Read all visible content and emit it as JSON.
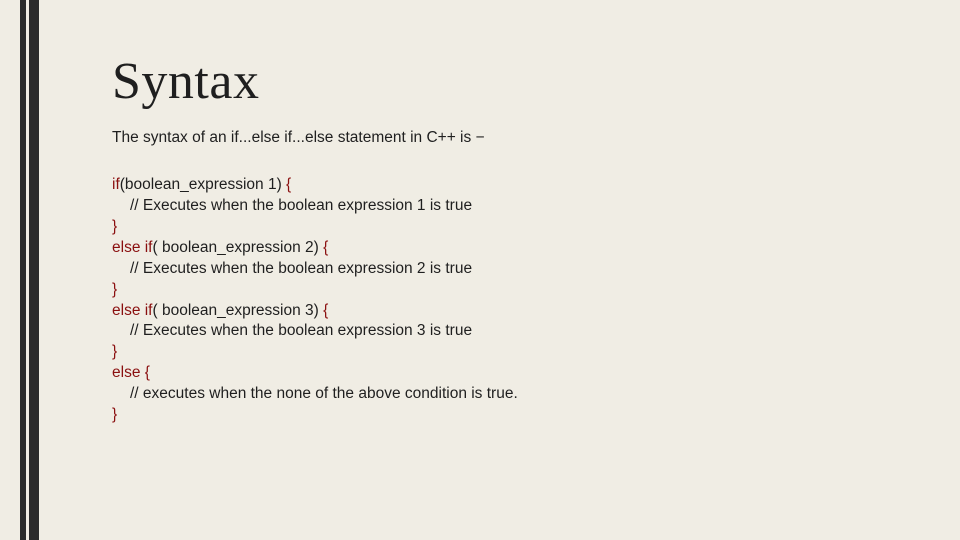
{
  "title": "Syntax",
  "intro": "The syntax of an if...else if...else statement in C++ is −",
  "code": {
    "l1a": "if",
    "l1b": "(boolean_expression 1)",
    "l1c": " {",
    "l2": "// Executes when the boolean expression 1 is true",
    "l3": "}",
    "l4a": "else if",
    "l4b": "( boolean_expression 2)",
    "l4c": " {",
    "l5": "// Executes when the boolean expression 2 is true",
    "l6": "}",
    "l7a": "else if",
    "l7b": "( boolean_expression 3)",
    "l7c": " {",
    "l8": "// Executes when the boolean expression 3 is true",
    "l9": "}",
    "l10a": "else",
    "l10b": " {",
    "l11": "// executes when the none of the above condition is true.",
    "l12": "}"
  }
}
